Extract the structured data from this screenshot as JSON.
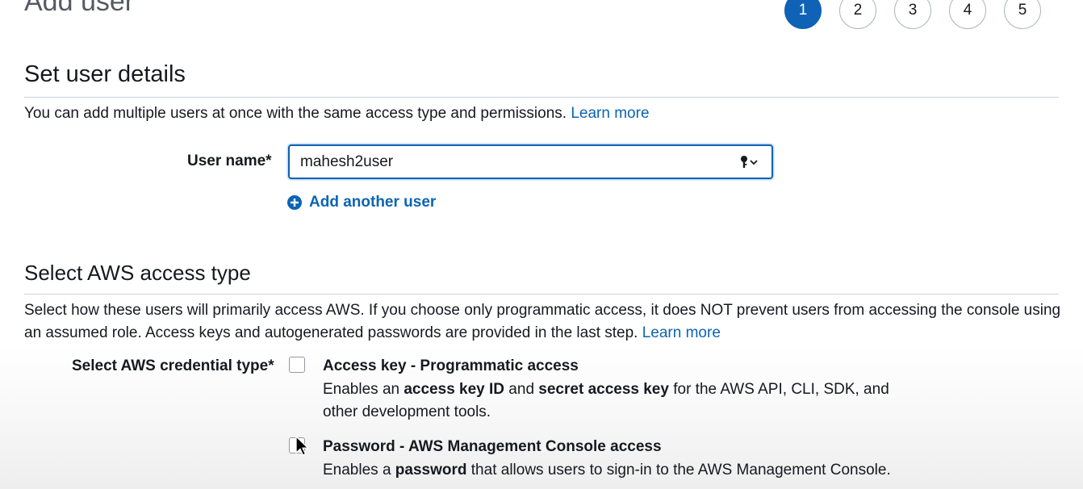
{
  "page": {
    "title": "Add user"
  },
  "steps": [
    "1",
    "2",
    "3",
    "4",
    "5"
  ],
  "user_details": {
    "title": "Set user details",
    "description": "You can add multiple users at once with the same access type and permissions.",
    "learn_more": "Learn more",
    "user_name_label": "User name*",
    "user_name_value": "mahesh2user",
    "add_another_user": "Add another user"
  },
  "access_type": {
    "title": "Select AWS access type",
    "description": "Select how these users will primarily access AWS. If you choose only programmatic access, it does NOT prevent users from accessing the console using an assumed role. Access keys and autogenerated passwords are provided in the last step.",
    "learn_more": "Learn more",
    "credential_label": "Select AWS credential type*",
    "options": [
      {
        "title": "Access key - Programmatic access",
        "desc_parts": [
          "Enables an ",
          "access key ID",
          " and ",
          "secret access key",
          " for the AWS API, CLI, SDK, and other development tools."
        ]
      },
      {
        "title": "Password - AWS Management Console access",
        "desc_parts": [
          "Enables a ",
          "password",
          " that allows users to sign-in to the AWS Management Console."
        ]
      }
    ]
  },
  "colors": {
    "primary": "#0f62b5",
    "link": "#0b64b4",
    "text": "#16191f"
  }
}
